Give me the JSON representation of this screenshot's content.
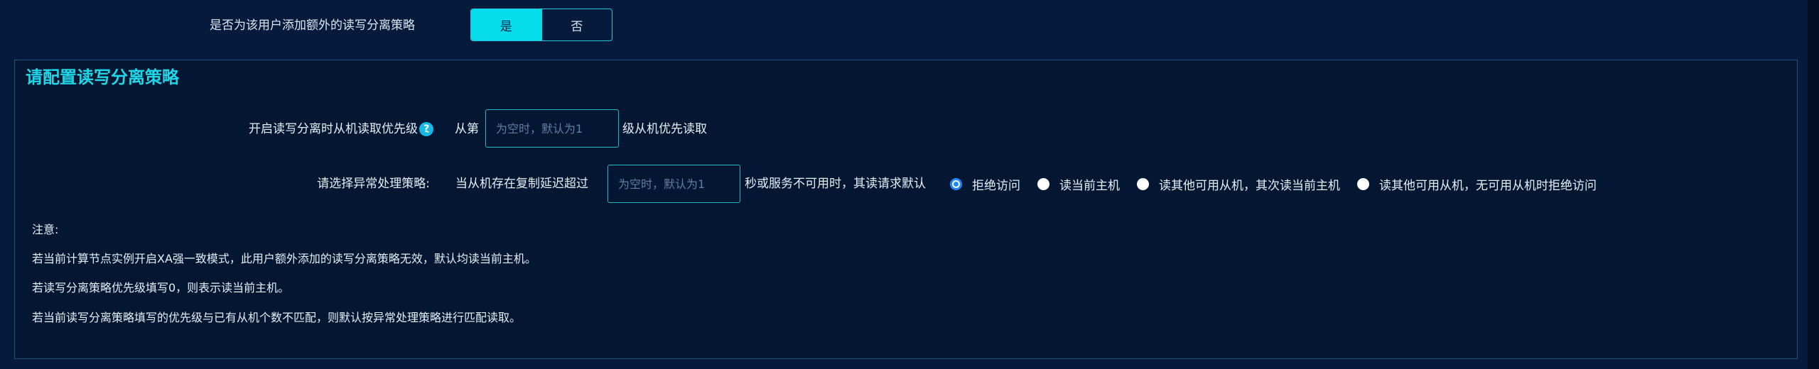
{
  "top": {
    "question": "是否为该用户添加额外的读写分离策略",
    "toggle": {
      "yes": "是",
      "no": "否",
      "selected": "是"
    }
  },
  "panel": {
    "title": "请配置读写分离策略",
    "priority": {
      "label": "开启读写分离时从机读取优先级",
      "colon": "：",
      "prefix": "从第",
      "placeholder": "为空时，默认为1",
      "suffix": "级从机优先读取"
    },
    "exception": {
      "label": "请选择异常处理策略:",
      "prefix": "当从机存在复制延迟超过",
      "placeholder": "为空时，默认为1",
      "suffix": "秒或服务不可用时，其读请求默认",
      "options": [
        "拒绝访问",
        "读当前主机",
        "读其他可用从机，其次读当前主机",
        "读其他可用从机，无可用从机时拒绝访问"
      ],
      "selected": "拒绝访问"
    },
    "notes": {
      "title": "注意:",
      "lines": [
        "若当前计算节点实例开启XA强一致模式，此用户额外添加的读写分离策略无效，默认均读当前主机。",
        "若读写分离策略优先级填写0，则表示读当前主机。",
        "若当前读写分离策略填写的优先级与已有从机个数不匹配，则默认按异常处理策略进行匹配读取。"
      ]
    }
  },
  "icons": {
    "help": "question-mark-icon",
    "help_glyph": "?"
  },
  "colors": {
    "accent": "#06dceb",
    "background": "#061a3b",
    "radio_checked": "#1e88ff"
  }
}
